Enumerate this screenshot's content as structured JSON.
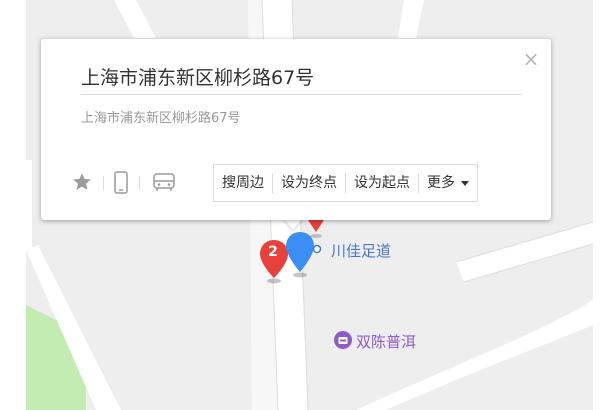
{
  "popup": {
    "title": "上海市浦东新区柳杉路67号",
    "subtitle": "上海市浦东新区柳杉路67号",
    "actions": {
      "nearby": "搜周边",
      "set_destination": "设为终点",
      "set_origin": "设为起点",
      "more": "更多"
    },
    "icons": [
      "star-icon",
      "phone-icon",
      "car-icon",
      "close-icon"
    ]
  },
  "map": {
    "labels": {
      "poi_1": "川佳足道",
      "poi_2": "双陈普洱"
    },
    "markers": {
      "numbered_marker": "2"
    },
    "colors": {
      "background": "#eeeeee",
      "road": "#ffffff",
      "park": "#c3ecb2",
      "red_marker": "#e8403a",
      "blue_marker": "#3a8ef5",
      "poi_blue": "#4a78c8",
      "poi_purple": "#8e5cc6"
    }
  }
}
